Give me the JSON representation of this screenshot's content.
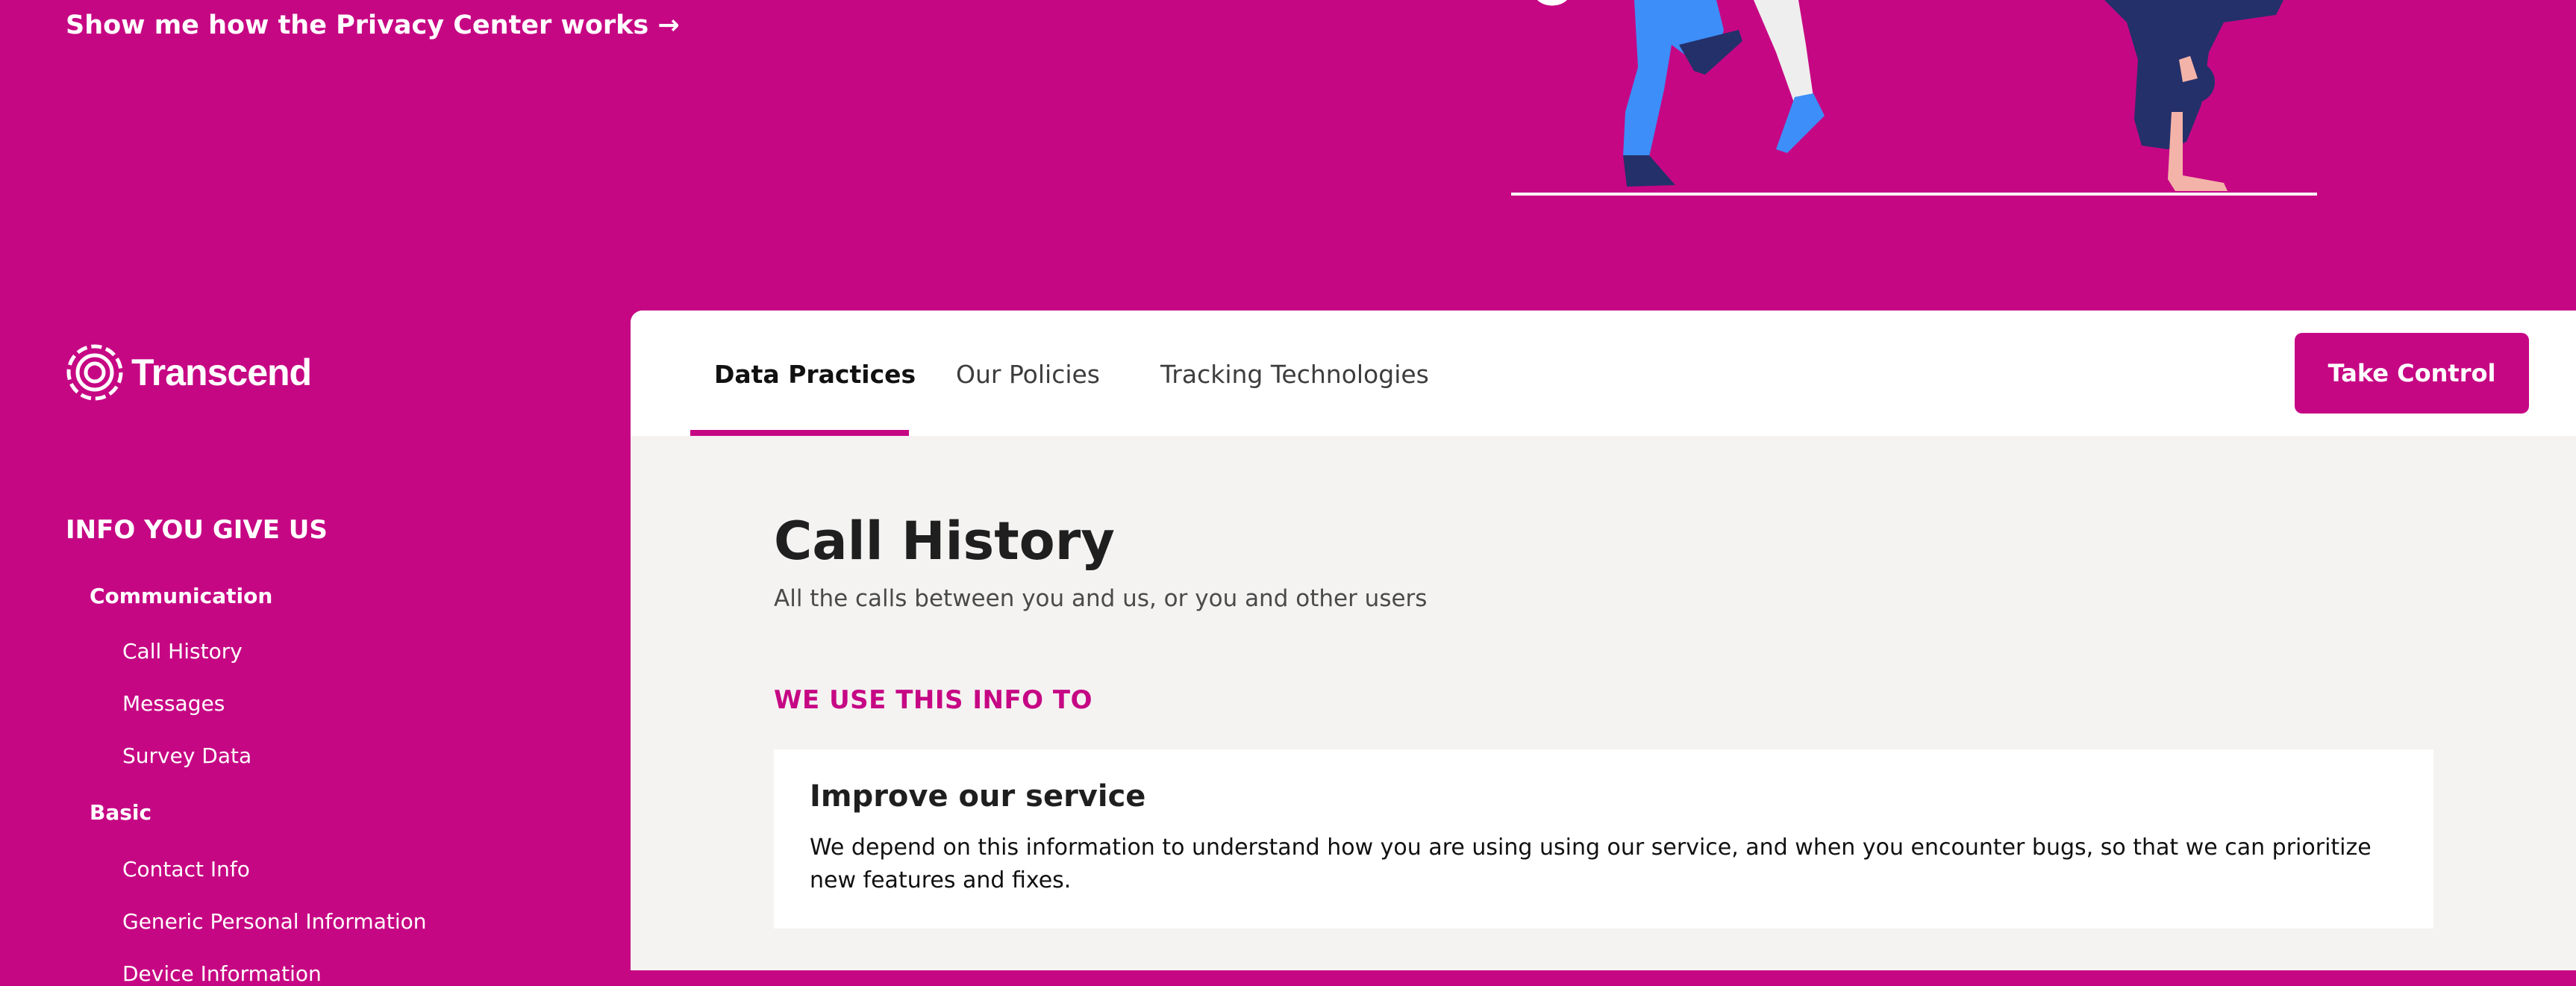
{
  "hero": {
    "link_text": "Show me how the Privacy Center works →"
  },
  "brand": {
    "name": "Transcend",
    "accent_color": "#c60784",
    "logo_icon": "transcend-logo-icon"
  },
  "sidebar": {
    "heading": "INFO YOU GIVE US",
    "groups": [
      {
        "label": "Communication",
        "items": [
          "Call History",
          "Messages",
          "Survey Data"
        ]
      },
      {
        "label": "Basic",
        "items": [
          "Contact Info",
          "Generic Personal Information",
          "Device Information"
        ]
      }
    ]
  },
  "tabs": [
    {
      "label": "Data Practices",
      "active": true
    },
    {
      "label": "Our Policies",
      "active": false
    },
    {
      "label": "Tracking Technologies",
      "active": false
    }
  ],
  "cta": {
    "label": "Take Control"
  },
  "content": {
    "title": "Call History",
    "subtitle": "All the calls between you and us, or you and other users",
    "section_label": "WE USE THIS INFO TO",
    "card": {
      "title": "Improve our service",
      "text": "We depend on this information to understand how you are using using our service, and when you encounter bugs, so that we can prioritize new features and fixes."
    }
  }
}
